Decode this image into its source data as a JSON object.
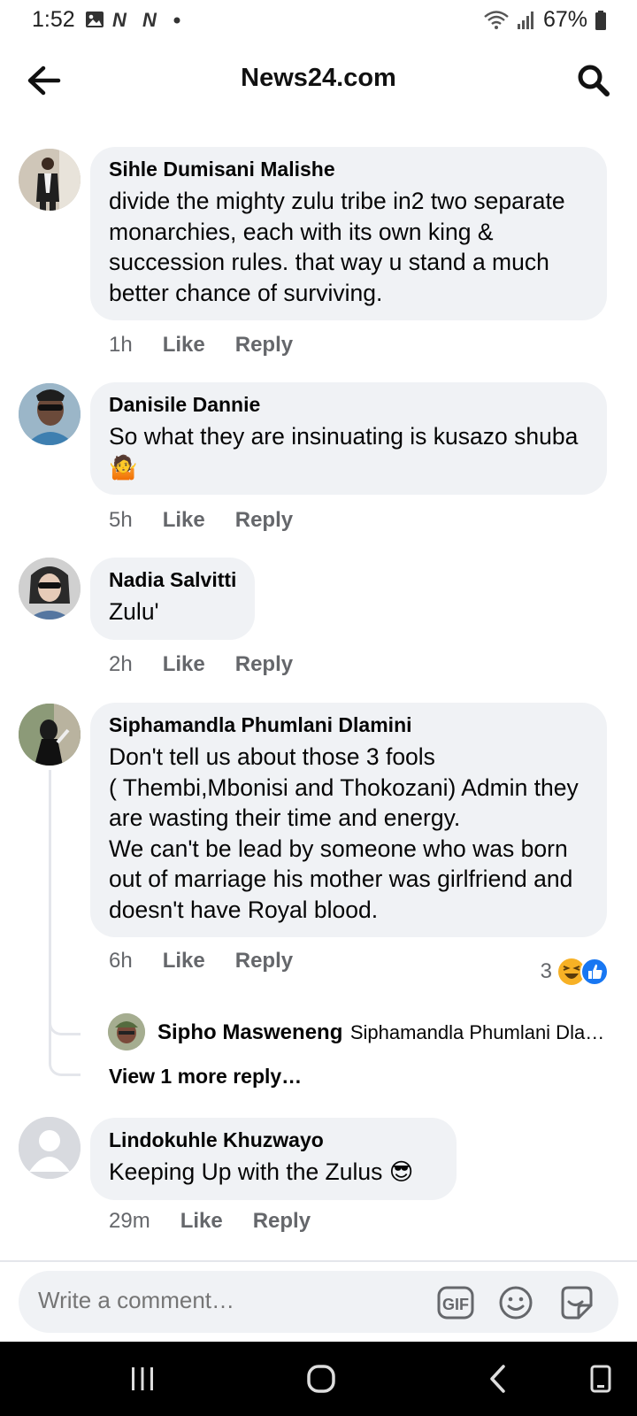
{
  "status_bar": {
    "time": "1:52",
    "battery": "67%"
  },
  "header": {
    "title": "News24.com",
    "back_icon": "arrow-left-icon",
    "search_icon": "search-icon"
  },
  "comments": [
    {
      "author": "Sihle Dumisani Malishe",
      "text": "divide the mighty zulu tribe in2 two separate monarchies, each with its own king & succession rules. that way u stand a much better chance of surviving.",
      "time": "1h",
      "like": "Like",
      "reply": "Reply"
    },
    {
      "author": "Danisile Dannie",
      "text": "So what they are insinuating is kusazo shuba",
      "emoji": "🤷",
      "time": "5h",
      "like": "Like",
      "reply": "Reply"
    },
    {
      "author": "Nadia Salvitti",
      "text": "Zulu'",
      "time": "2h",
      "like": "Like",
      "reply": "Reply"
    },
    {
      "author": "Siphamandla Phumlani Dlamini",
      "text": "Don't tell us about those 3 fools\n( Thembi,Mbonisi and Thokozani)  Admin they are wasting their time and energy.\nWe can't be lead by someone who was born out of marriage his mother was girlfriend and doesn't have Royal blood.",
      "time": "6h",
      "like": "Like",
      "reply": "Reply",
      "reaction_count": "3",
      "reply_preview": {
        "author": "Sipho Masweneng",
        "snippet": "Siphamandla Phumlani Dla…"
      },
      "view_more": "View 1 more reply…"
    },
    {
      "author": "Lindokuhle Khuzwayo",
      "text": "Keeping Up with the Zulus",
      "emoji": "😎",
      "time": "29m",
      "like": "Like",
      "reply": "Reply"
    }
  ],
  "composer": {
    "placeholder": "Write a comment…",
    "gif_label": "GIF"
  },
  "colors": {
    "bubble": "#f0f2f5",
    "secondary_text": "#65676b",
    "like_blue": "#1877f2",
    "haha_yellow": "#f7b125"
  }
}
